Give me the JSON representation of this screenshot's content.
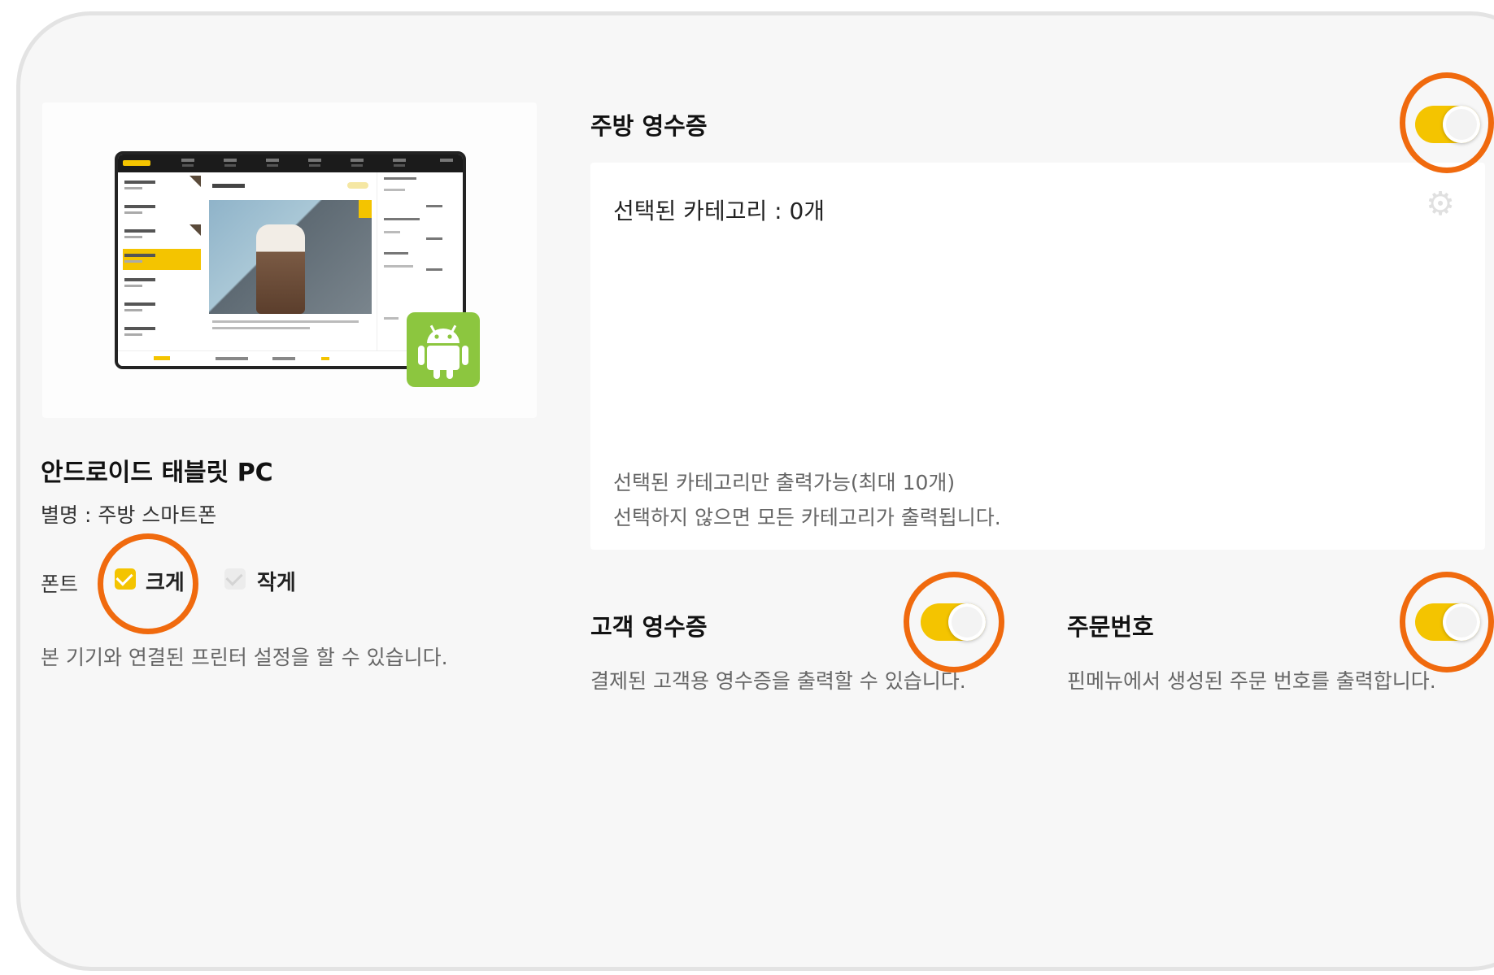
{
  "device": {
    "preview_image_name": "android-tablet-pos-preview",
    "badge_icon": "android-icon",
    "title": "안드로이드 태블릿 PC",
    "alias_label": "별명 : 주방 스마트폰"
  },
  "font": {
    "label": "폰트",
    "options": [
      {
        "label": "크게",
        "checked": true
      },
      {
        "label": "작게",
        "checked": false
      }
    ]
  },
  "left_description": "본 기기와 연결된 프린터 설정을 할 수 있습니다.",
  "kitchen_receipt": {
    "title": "주방 영수증",
    "enabled": true,
    "selected_categories": "선택된 카테고리 : 0개",
    "settings_icon": "gear-icon",
    "notes": [
      "선택된 카테고리만 출력가능(최대 10개)",
      "선택하지 않으면 모든 카테고리가 출력됩니다."
    ]
  },
  "customer_receipt": {
    "title": "고객 영수증",
    "enabled": true,
    "description": "결제된 고객용 영수증을 출력할 수 있습니다."
  },
  "order_number": {
    "title": "주문번호",
    "enabled": true,
    "description": "핀메뉴에서 생성된 주문 번호를 출력합니다."
  },
  "colors": {
    "accent": "#f4c400",
    "highlight_ring": "#f06a0e",
    "android_green": "#8cc63f"
  }
}
